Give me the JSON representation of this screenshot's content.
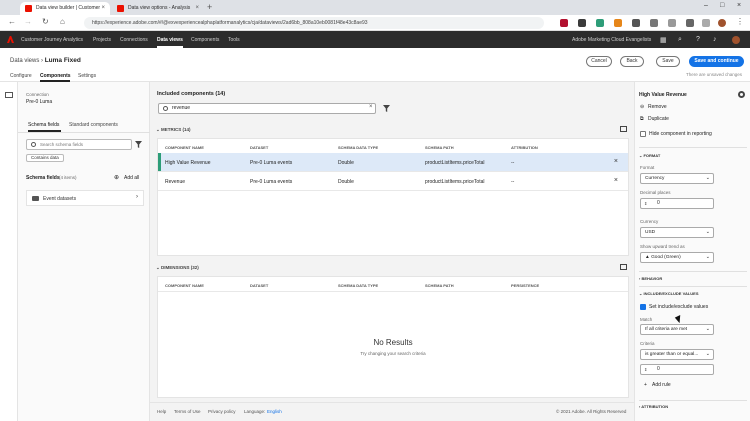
{
  "browser": {
    "tabs": [
      {
        "title": "Data view builder | Customer"
      },
      {
        "title": "Data view options - Analysis"
      }
    ],
    "url": "https://experience.adobe.com/#/@exvexperiencealphaplatformanalytics/cja/dataviews/2ad6bb_808a10eb0081f48e43c8ae93"
  },
  "app": {
    "product": "Customer Journey Analytics",
    "nav": [
      "Projects",
      "Connections",
      "Data views",
      "Components",
      "Tools"
    ],
    "org": "Adobe Marketing Cloud Evangelists"
  },
  "topbar": {
    "crumb_root": "Data views",
    "crumb_sep": "›",
    "crumb_current": "Luma Fixed",
    "tabs": [
      "Configure",
      "Components",
      "Settings"
    ],
    "buttons": {
      "cancel": "Cancel",
      "back": "Back",
      "save": "Save",
      "save_continue": "Save and continue"
    },
    "unsaved": "There are unsaved changes"
  },
  "left": {
    "connection_label": "Connection",
    "connection_value": "Pre-0 Luma",
    "tabs": [
      "Schema fields",
      "Standard components"
    ],
    "search_placeholder": "Search schema fields",
    "chip": "Contains data",
    "schema_label": "Schema fields",
    "schema_count": "(4 items)",
    "add_all": "Add all",
    "folder": "Event datasets"
  },
  "center": {
    "title": "Included components (14)",
    "search_value": "revenue",
    "metrics": {
      "heading": "METRICS (14)",
      "columns": [
        "COMPONENT NAME",
        "DATASET",
        "SCHEMA DATA TYPE",
        "SCHEMA PATH",
        "ATTRIBUTION"
      ],
      "rows": [
        {
          "name": "High Value Revenue",
          "dataset": "Pre-0 Luma events",
          "type": "Double",
          "path": "productListItems.priceTotal",
          "attribution": "--"
        },
        {
          "name": "Revenue",
          "dataset": "Pre-0 Luma events",
          "type": "Double",
          "path": "productListItems.priceTotal",
          "attribution": "--"
        }
      ]
    },
    "dimensions": {
      "heading": "DIMENSIONS (32)",
      "columns": [
        "COMPONENT NAME",
        "DATASET",
        "SCHEMA DATA TYPE",
        "SCHEMA PATH",
        "PERSISTENCE"
      ],
      "no_results": "No Results",
      "no_results_hint": "Try changing your search criteria"
    },
    "footer": {
      "help": "Help",
      "terms": "Terms of Use",
      "privacy": "Privacy policy",
      "language_label": "Language:",
      "language": "English",
      "copyright": "© 2021 Adobe. All Rights Reserved"
    }
  },
  "right": {
    "title": "High Value Revenue",
    "remove": "Remove",
    "duplicate": "Duplicate",
    "hide_label": "Hide component in reporting",
    "format_section": "FORMAT",
    "format_label": "Format",
    "format_value": "Currency",
    "decimal_label": "Decimal places",
    "decimal_value": "0",
    "currency_label": "Currency",
    "currency_value": "USD",
    "trend_label": "Show upward trend as",
    "trend_value": "▲ Good (Green)",
    "behavior_section": "BEHAVIOR",
    "include_section": "INCLUDE/EXCLUDE VALUES",
    "set_include": "Set include/exclude values",
    "match_label": "Match",
    "match_value": "If all criteria are met",
    "criteria_label": "Criteria",
    "criteria_value": "is greater than or equal...",
    "criteria_number": "0",
    "add_rule": "Add rule",
    "attribution_section": "ATTRIBUTION"
  }
}
